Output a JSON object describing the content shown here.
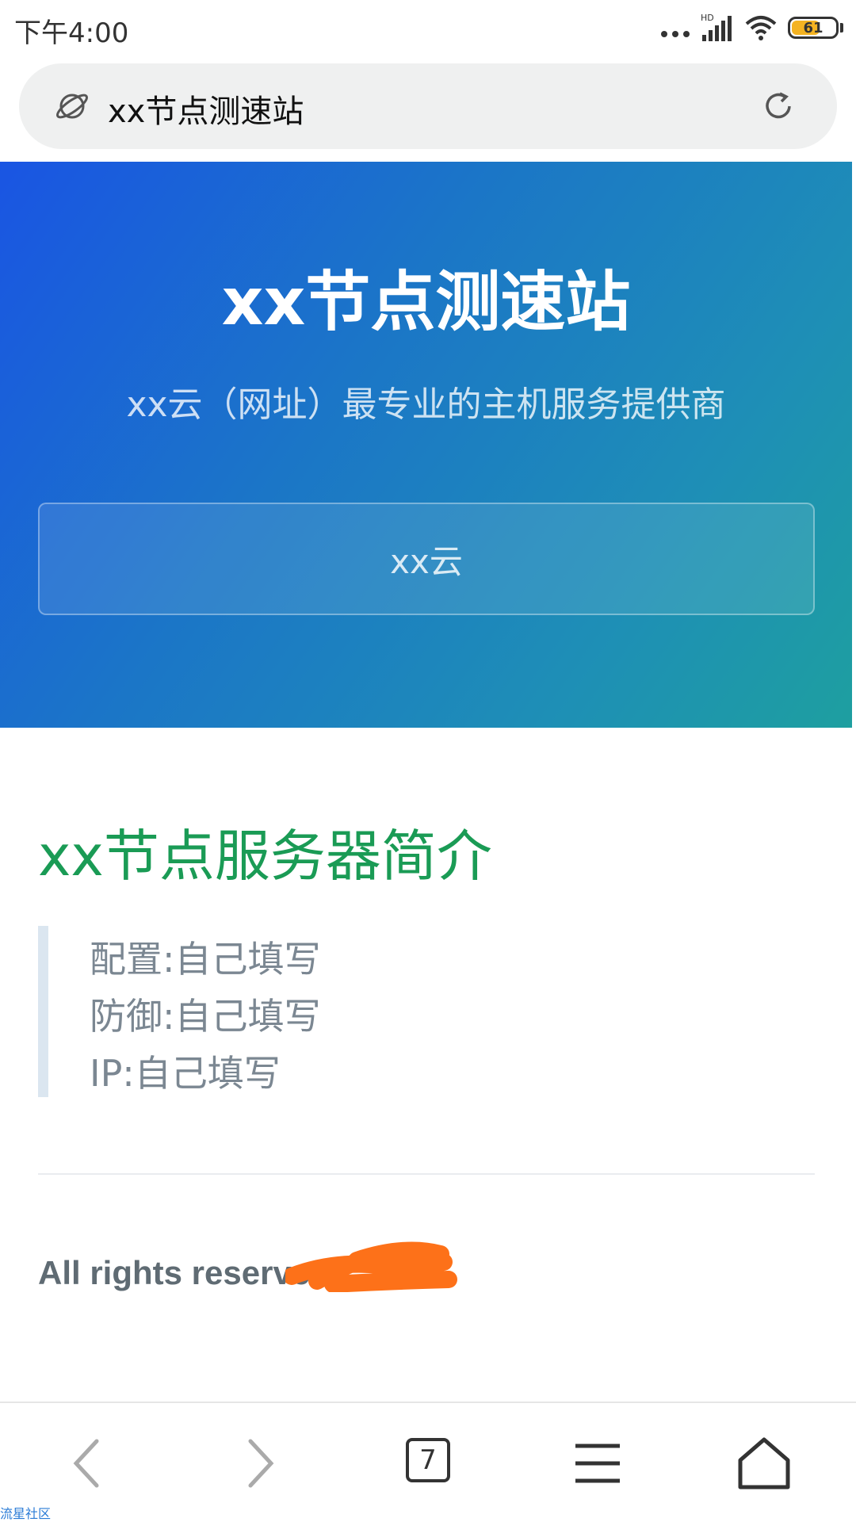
{
  "status_bar": {
    "time": "下午4:00",
    "network": "HD",
    "battery_level": "61",
    "battery_fraction": 0.61
  },
  "address_bar": {
    "text": "xx节点测速站",
    "left_icon": "planet-icon",
    "right_icon": "refresh-icon"
  },
  "hero": {
    "title": "xx节点测速站",
    "subtitle": "xx云（网址）最专业的主机服务提供商",
    "button_label": "xx云"
  },
  "content": {
    "heading": "xx节点服务器简介",
    "items": [
      "配置:自己填写",
      "防御:自己填写",
      "IP:自己填写"
    ],
    "footer": "All rights reserved"
  },
  "bottom_nav": {
    "tab_count": "7",
    "icons": [
      "back-icon",
      "forward-icon",
      "tabs-icon",
      "menu-icon",
      "home-icon"
    ]
  },
  "watermark": "流星社区",
  "colors": {
    "hero_gradient_start": "#1a55e3",
    "hero_gradient_end": "#1e9fa0",
    "heading_green": "#1a9b55",
    "scribble_orange": "#fd7119"
  }
}
